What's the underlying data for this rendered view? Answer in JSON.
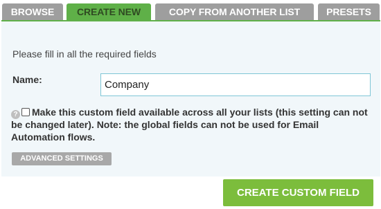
{
  "tabs": [
    {
      "label": "BROWSE",
      "active": false
    },
    {
      "label": "CREATE NEW",
      "active": true
    },
    {
      "label": "COPY FROM ANOTHER LIST",
      "active": false
    },
    {
      "label": "PRESETS",
      "active": false
    }
  ],
  "form": {
    "intro": "Please fill in all the required fields",
    "name_label": "Name:",
    "name_value": "Company",
    "global_text": "Make this custom field available across all your lists (this setting can not be changed later). Note: the global fields can not be used for Email Automation flows.",
    "global_checked": false,
    "help_icon_glyph": "?",
    "advanced_label": "ADVANCED SETTINGS"
  },
  "actions": {
    "create_label": "CREATE CUSTOM FIELD"
  },
  "colors": {
    "active_tab": "#5fb048",
    "inactive_tab": "#9e9e9e",
    "panel_bg": "#f1f7fa",
    "primary_button": "#7cbd3c",
    "secondary_button": "#a8a8a8",
    "input_border": "#7fc6d6"
  }
}
